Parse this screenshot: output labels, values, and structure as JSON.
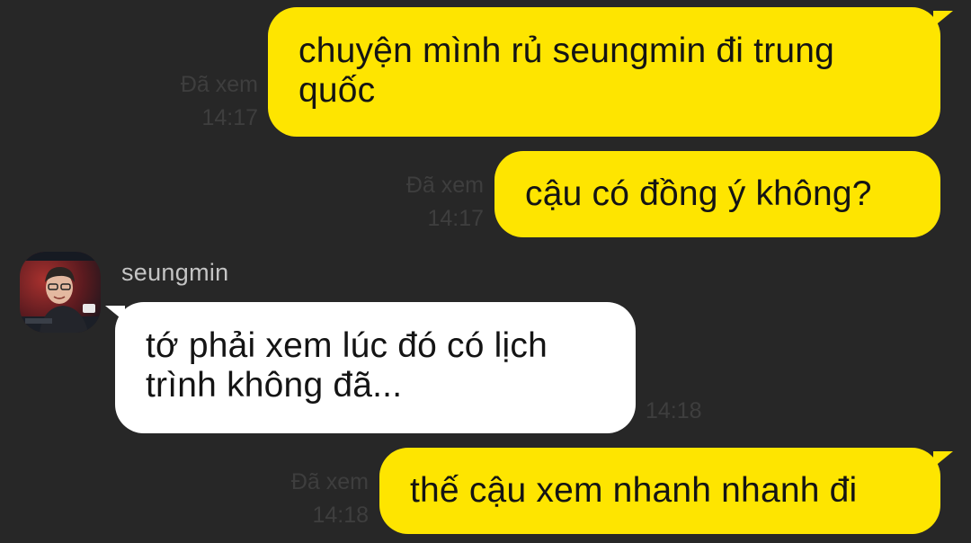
{
  "chat": {
    "messages": [
      {
        "direction": "out",
        "line1": "chuyện mình rủ seungmin đi trung",
        "line2": "quốc",
        "status": "Đã xem",
        "time": "14:17"
      },
      {
        "direction": "out",
        "line1": "cậu có đồng ý không?",
        "status": "Đã xem",
        "time": "14:17"
      },
      {
        "direction": "in",
        "sender": "seungmin",
        "line1": "tớ phải xem lúc đó có lịch",
        "line2": "trình không đã...",
        "time": "14:18"
      },
      {
        "direction": "out",
        "line1": "thế cậu xem nhanh nhanh đi",
        "status": "Đã xem",
        "time": "14:18"
      }
    ]
  },
  "colors": {
    "background": "#272727",
    "outgoing_bubble": "#fee500",
    "incoming_bubble": "#ffffff",
    "meta_text": "#3e3e3e",
    "sender_name": "#c4c4c4"
  },
  "icons": {
    "avatar": "profile-photo"
  }
}
